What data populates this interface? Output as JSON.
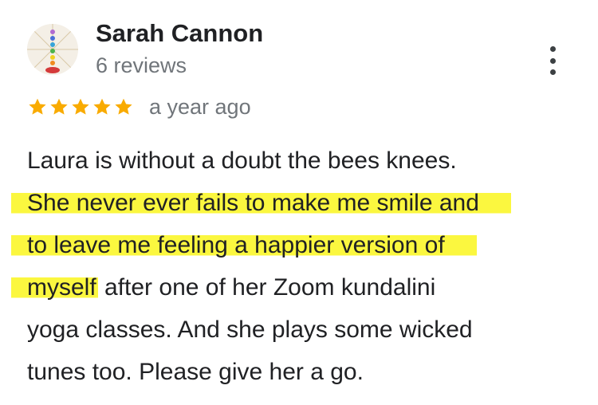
{
  "reviewer": {
    "name": "Sarah Cannon",
    "reviews_count": "6 reviews"
  },
  "rating": {
    "stars": 5,
    "max": 5,
    "star_color": "#f9ab00",
    "time": "a year ago"
  },
  "review": {
    "line1": "Laura is without a doubt the bees knees.",
    "line2": "She never ever fails to make me smile and",
    "line3": "to leave me feeling a happier version of",
    "line4_highlighted": "myself",
    "line4_rest": " after one of her Zoom kundalini",
    "line5": "yoga classes. And she plays some wicked",
    "line6": "tunes too. Please give her a go."
  },
  "highlight_color": "#fbf73f",
  "icons": {
    "more": "more-vert-icon",
    "star": "star-icon"
  }
}
